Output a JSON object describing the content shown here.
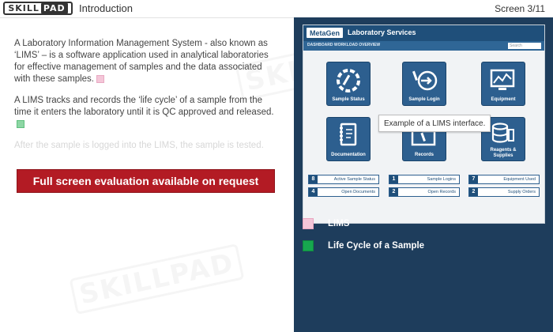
{
  "header": {
    "logo_left": "SKILL",
    "logo_right": "PAD",
    "title": "Introduction",
    "screen": "Screen 3/11"
  },
  "content": {
    "p1": "A Laboratory Information Management System - also known as ‘LIMS’ – is a software application used in analytical laboratories for effective management of samples and the data associated with these samples.",
    "p2": "A LIMS tracks and records the ‘life cycle’ of a sample from the time it enters the laboratory until it is QC approved and released.",
    "p3": "After the sample is logged into the LIMS, the sample is tested.",
    "cta": "Full screen evaluation available on request"
  },
  "watermark": "SKILLPAD",
  "lims": {
    "logo": "MetaGen",
    "title": "Laboratory Services",
    "subtitle": "DASHBOARD WORKLOAD OVERVIEW",
    "search_placeholder": "Search",
    "tiles": [
      {
        "label": "Sample Status",
        "icon": "sample-status-icon"
      },
      {
        "label": "Sample Login",
        "icon": "sample-login-icon"
      },
      {
        "label": "Equipment",
        "icon": "equipment-icon"
      },
      {
        "label": "Documentation",
        "icon": "documentation-icon"
      },
      {
        "label": "Records",
        "icon": "records-icon"
      },
      {
        "label": "Reagents & Supplies",
        "icon": "reagents-icon"
      }
    ],
    "tooltip": "Example of a LIMS interface.",
    "stats": [
      {
        "num": "8",
        "label": "Active Sample Status"
      },
      {
        "num": "1",
        "label": "Sample Logins"
      },
      {
        "num": "7",
        "label": "Equipment Used"
      },
      {
        "num": "4",
        "label": "Open Documents"
      },
      {
        "num": "2",
        "label": "Open Records"
      },
      {
        "num": "2",
        "label": "Supply Orders"
      }
    ]
  },
  "legend": [
    {
      "label": "LIMS",
      "color": "#f4c6d8"
    },
    {
      "label": "Life Cycle of a Sample",
      "color": "#17a84f"
    }
  ],
  "colors": {
    "panel": "#1e3d5c",
    "cta": "#b31b24",
    "tile": "#2d5f8f"
  }
}
